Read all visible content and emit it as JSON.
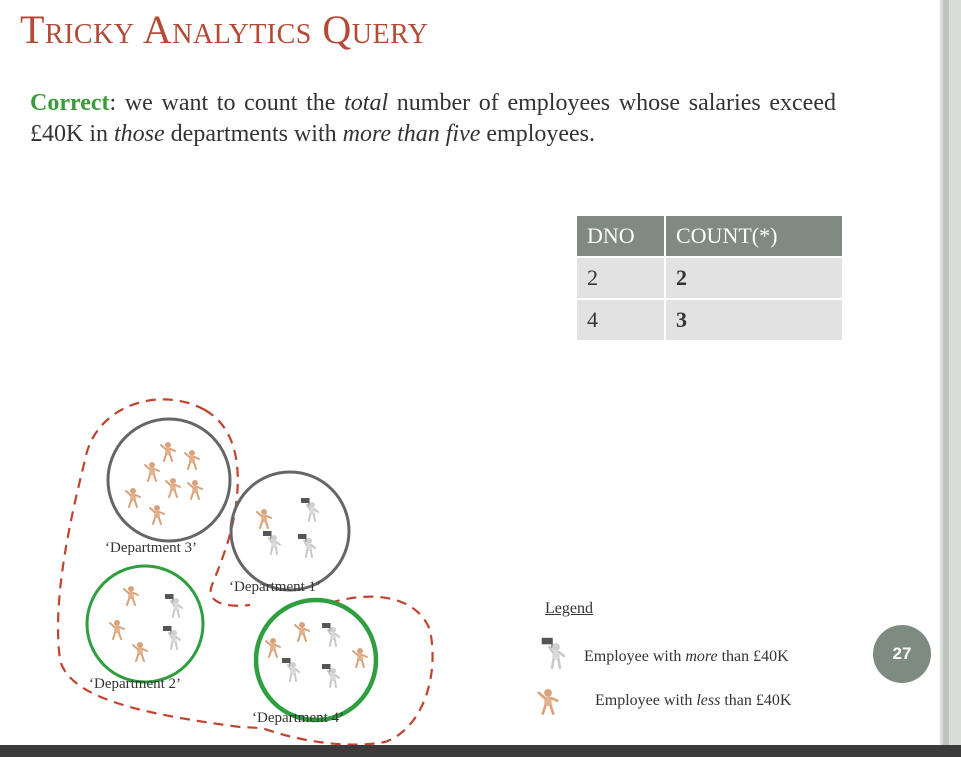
{
  "title": "Tricky Analytics Query",
  "paragraph": {
    "correct_label": "Correct",
    "s1": ": we want to count the ",
    "e1": "total",
    "s2": " number of employees whose salaries exceed £40K in ",
    "e2": "those",
    "s3": " departments with ",
    "e3": "more than five",
    "s4": " employees."
  },
  "table": {
    "headers": [
      "DNO",
      "COUNT(*)"
    ],
    "rows": [
      [
        "2",
        "2"
      ],
      [
        "4",
        "3"
      ]
    ]
  },
  "departments": [
    "‘Department 3’",
    "‘Department 1’",
    "‘Department 2’",
    "‘Department 4’"
  ],
  "legend": {
    "title": "Legend",
    "more_pre": "Employee with ",
    "more_em": "more",
    "more_post": " than £40K",
    "less_pre": "Employee with ",
    "less_em": "less",
    "less_post": " than £40K",
    "icon_more": "flag-person-icon",
    "icon_less": "person-icon"
  },
  "page_number": "27",
  "colors": {
    "title": "#b44a36",
    "correct": "#3b9b3b",
    "dashed_group": "#c0432d",
    "qualified_circle": "#2e9e3e",
    "other_circle": "#666666",
    "table_header": "#808a83",
    "page_badge": "#7e8b81"
  }
}
